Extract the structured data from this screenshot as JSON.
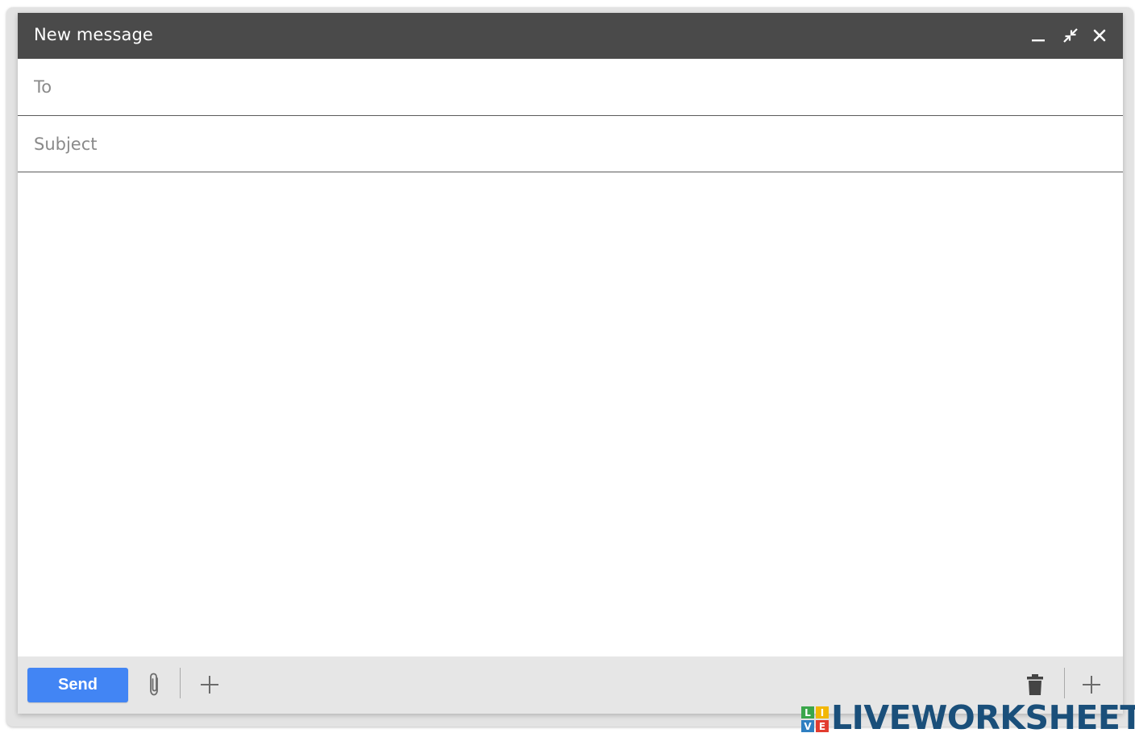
{
  "window": {
    "title": "New message"
  },
  "fields": {
    "to_placeholder": "To",
    "subject_placeholder": "Subject"
  },
  "toolbar": {
    "send_label": "Send"
  },
  "icons": {
    "minimize": "minimize-icon",
    "expand": "expand-icon",
    "close": "close-icon",
    "attach": "paperclip-icon",
    "more": "plus-icon",
    "discard": "trash-icon"
  },
  "watermark": {
    "logo_letters": "LIVE",
    "text": "LIVEWORKSHEETS"
  },
  "colors": {
    "titlebar": "#4a4a4a",
    "send_button": "#4285f4",
    "bottombar": "#e6e6e6",
    "watermark": "#1a4f7a"
  }
}
